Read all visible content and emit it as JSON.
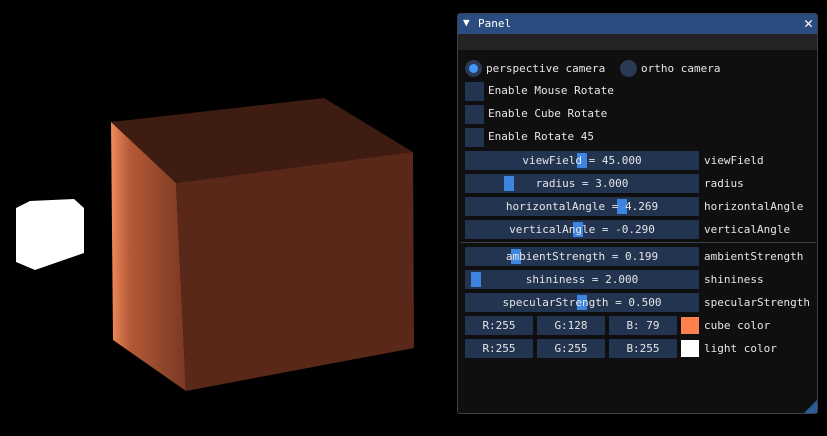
{
  "panel": {
    "title": "Panel"
  },
  "camera": {
    "perspective_label": "perspective camera",
    "ortho_label": "ortho camera",
    "selected": "perspective"
  },
  "checkboxes": {
    "mouse_rotate": "Enable Mouse Rotate",
    "cube_rotate": "Enable Cube Rotate",
    "rotate45": "Enable Rotate 45"
  },
  "sliders": [
    {
      "text": "viewField = 45.000",
      "label": "viewField",
      "fraction": 0.5
    },
    {
      "text": "radius = 3.000",
      "label": "radius",
      "fraction": 0.17
    },
    {
      "text": "horizontalAngle = 4.269",
      "label": "horizontalAngle",
      "fraction": 0.68
    },
    {
      "text": "verticalAngle = -0.290",
      "label": "verticalAngle",
      "fraction": 0.48
    },
    {
      "text": "ambientStrength = 0.199",
      "label": "ambientStrength",
      "fraction": 0.2
    },
    {
      "text": "shininess = 2.000",
      "label": "shininess",
      "fraction": 0.02
    },
    {
      "text": "specularStrength = 0.500",
      "label": "specularStrength",
      "fraction": 0.5
    }
  ],
  "colors": {
    "cube": {
      "r": "R:255",
      "g": "G:128",
      "b": "B: 79",
      "label": "cube color",
      "hex": "#ff804f"
    },
    "light": {
      "r": "R:255",
      "g": "G:255",
      "b": "B:255",
      "label": "light color",
      "hex": "#ffffff"
    }
  },
  "icons": {
    "collapse": "triangle-down-icon",
    "close": "close-icon",
    "resize": "resize-grip-icon"
  }
}
